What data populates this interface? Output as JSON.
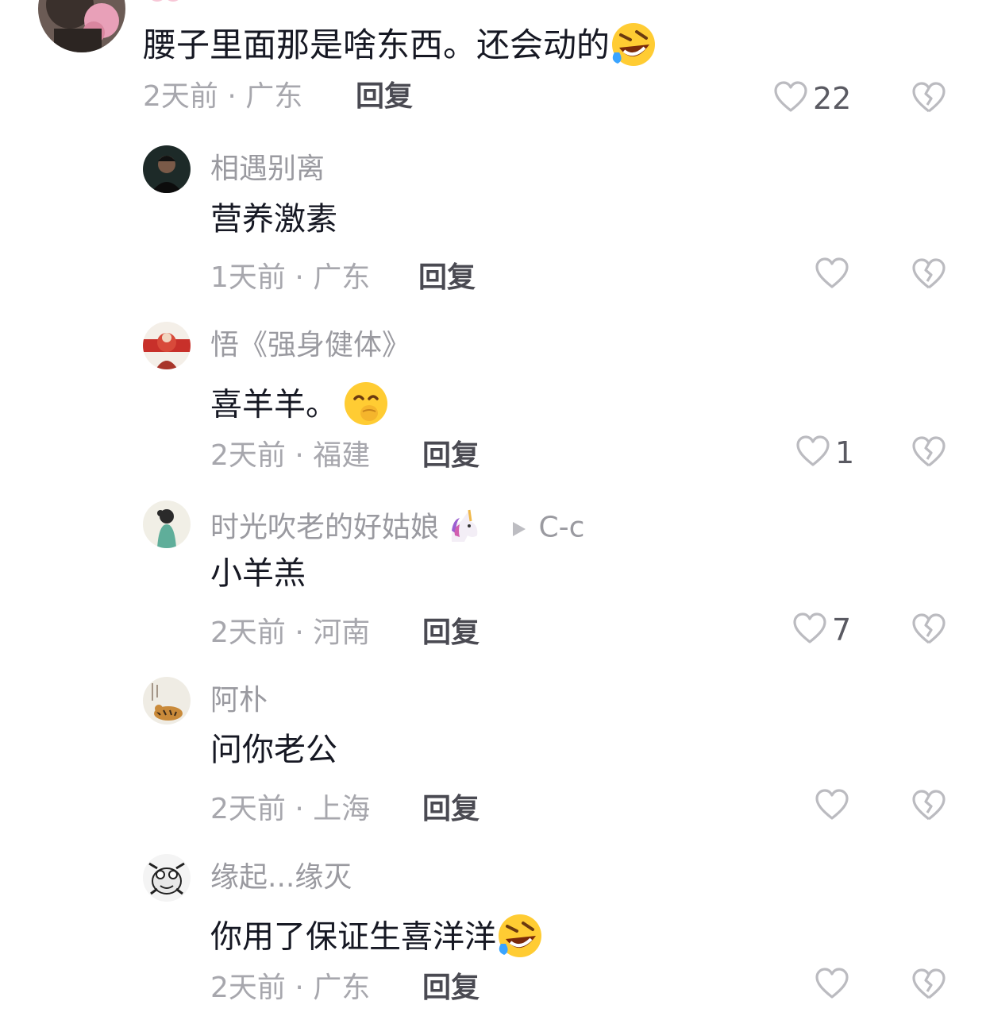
{
  "top_comment": {
    "text": "腰子里面那是啥东西。还会动的",
    "emoji": "rofl-emoji",
    "time": "2天前",
    "location": "广东",
    "reply_label": "回复",
    "likes": "22"
  },
  "replies": [
    {
      "username": "相遇别离",
      "text": "营养激素",
      "time": "1天前",
      "location": "广东",
      "reply_label": "回复",
      "likes": ""
    },
    {
      "username": "悟《强身健体》",
      "text": "喜羊羊。",
      "emoji": "shy-emoji",
      "time": "2天前",
      "location": "福建",
      "reply_label": "回复",
      "likes": "1"
    },
    {
      "username": "时光吹老的好姑娘",
      "username_emoji": "unicorn-emoji",
      "reply_to": "C-c",
      "text": "小羊羔",
      "time": "2天前",
      "location": "河南",
      "reply_label": "回复",
      "likes": "7"
    },
    {
      "username": "阿朴",
      "text": "问你老公",
      "time": "2天前",
      "location": "上海",
      "reply_label": "回复",
      "likes": ""
    },
    {
      "username": "缘起...缘灭",
      "text": "你用了保证生喜洋洋",
      "emoji": "rofl-emoji",
      "time": "2天前",
      "location": "广东",
      "reply_label": "回复",
      "likes": ""
    }
  ],
  "separator": "·",
  "colors": {
    "text": "#161823",
    "muted": "#a7a7ad",
    "username": "#9a9aa0"
  }
}
